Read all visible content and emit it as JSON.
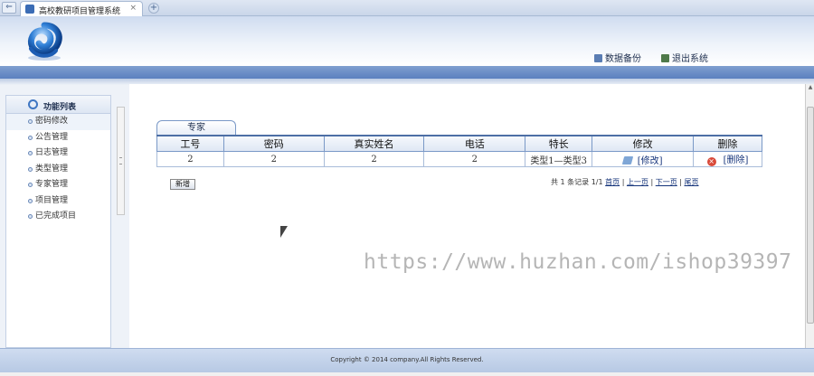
{
  "browser": {
    "tab_title": "高校教研项目管理系统",
    "tab_close": "×",
    "new_tab": "+",
    "back": "⇐"
  },
  "header": {
    "links": [
      {
        "label": "数据备份",
        "icon": "backup-icon"
      },
      {
        "label": "退出系统",
        "icon": "logout-icon"
      }
    ]
  },
  "sidebar": {
    "title": "功能列表",
    "items": [
      {
        "label": "密码修改"
      },
      {
        "label": "公告管理"
      },
      {
        "label": "日志管理"
      },
      {
        "label": "类型管理"
      },
      {
        "label": "专家管理"
      },
      {
        "label": "项目管理"
      },
      {
        "label": "已完成项目"
      }
    ]
  },
  "main": {
    "tab_label": "专家",
    "table": {
      "headers": [
        "工号",
        "密码",
        "真实姓名",
        "电话",
        "特长",
        "修改",
        "删除"
      ],
      "rows": [
        {
          "id": "2",
          "password": "2",
          "name": "2",
          "phone": "2",
          "specialty": "类型1—类型3",
          "edit": "[修改]",
          "delete": "[删除]"
        }
      ]
    },
    "add_button": "新增",
    "pager": {
      "summary": "共 1 条记录  1/1",
      "first": "首页",
      "sep": "|",
      "prev": "上一页",
      "next": "下一页",
      "last": "尾页"
    }
  },
  "watermark": "https://www.huzhan.com/ishop39397",
  "footer": {
    "copyright": "Copyright © 2014 company.All Rights Reserved."
  },
  "colors": {
    "nav_bar": "#5b80bf",
    "table_border": "#7a99c7",
    "link": "#14337a"
  }
}
